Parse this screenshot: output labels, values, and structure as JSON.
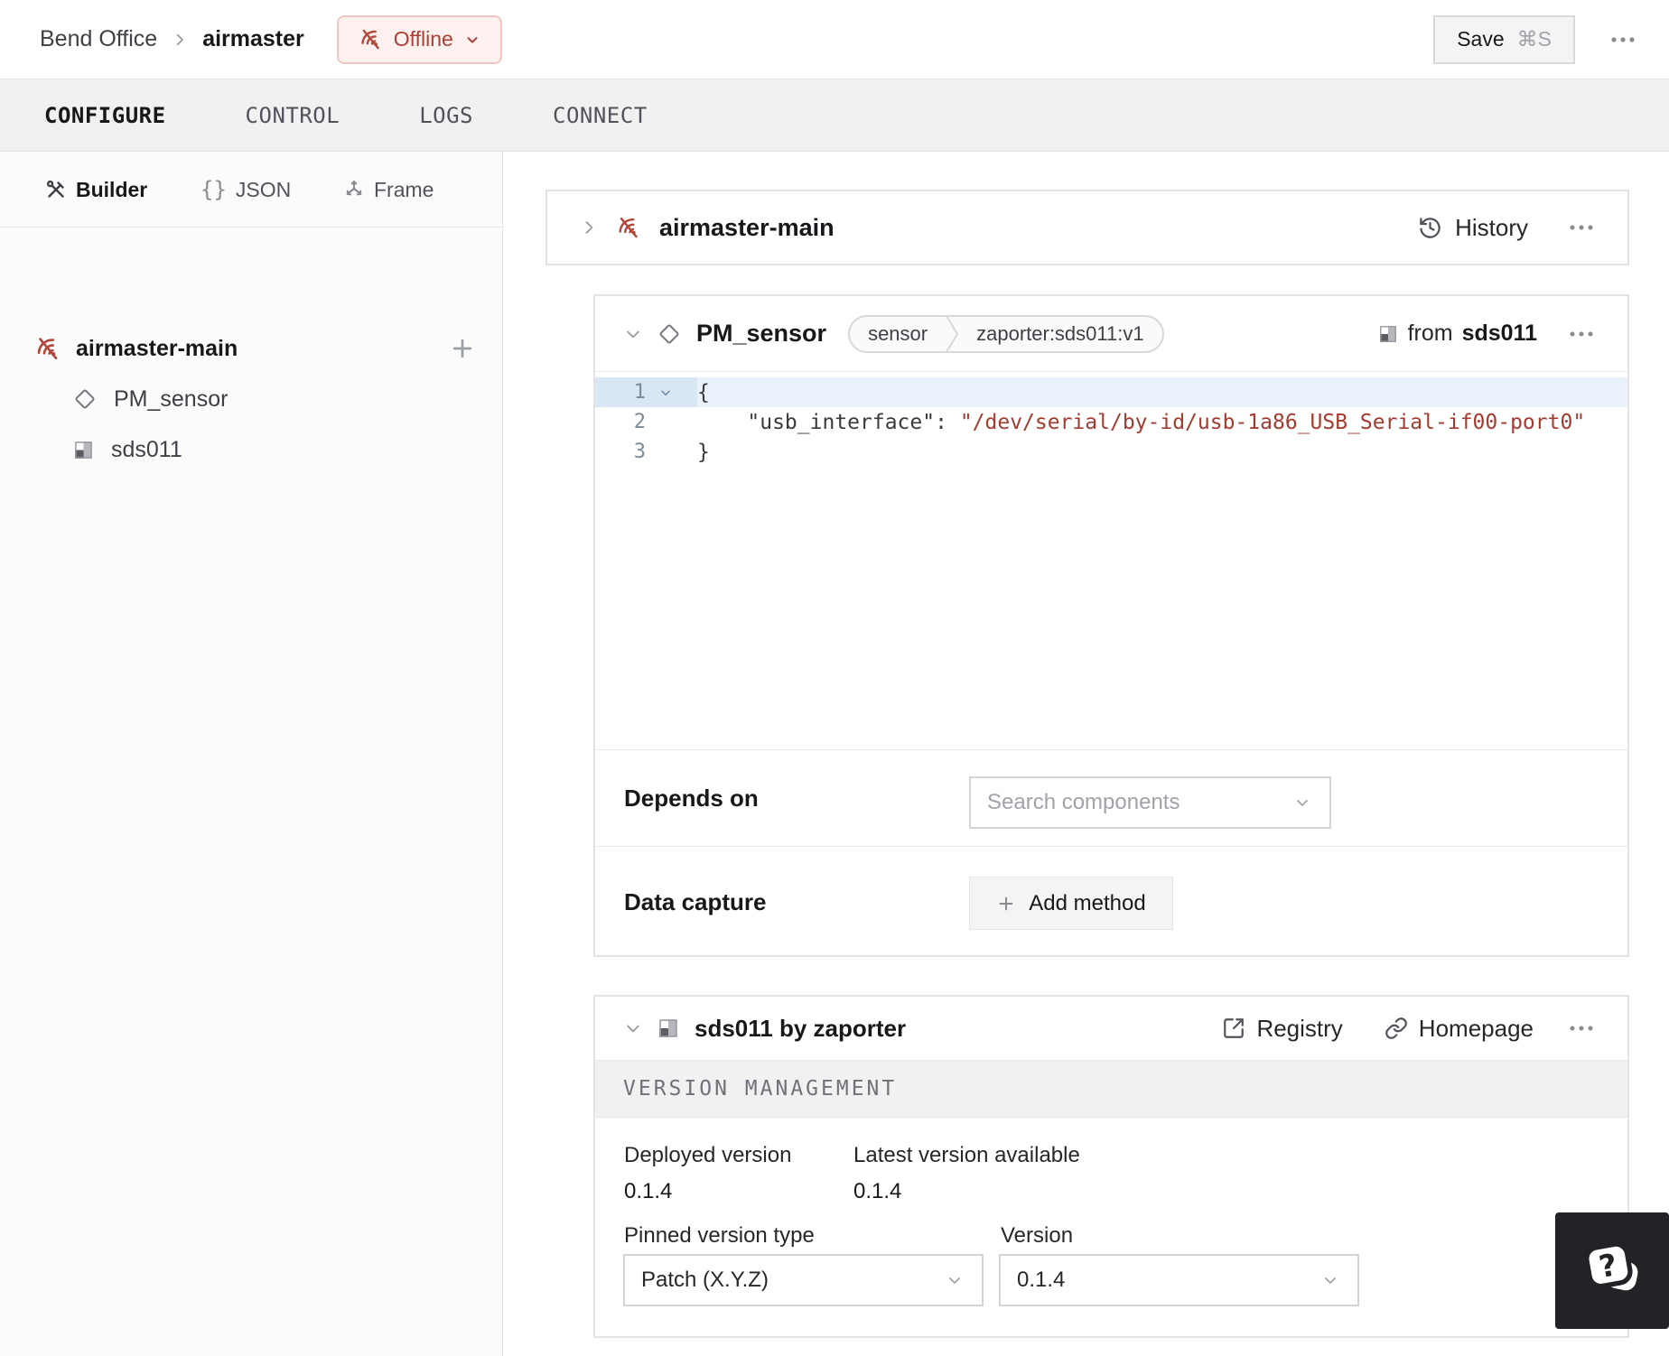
{
  "topbar": {
    "breadcrumb_parent": "Bend Office",
    "breadcrumb_current": "airmaster",
    "status_label": "Offline",
    "save_label": "Save",
    "save_shortcut": "⌘S"
  },
  "tabs": {
    "configure": "CONFIGURE",
    "control": "CONTROL",
    "logs": "LOGS",
    "connect": "CONNECT"
  },
  "sidebar": {
    "modes": {
      "builder": "Builder",
      "json": "JSON",
      "frame": "Frame"
    },
    "tree": {
      "root": "airmaster-main",
      "component": "PM_sensor",
      "module": "sds011"
    }
  },
  "machine_card": {
    "title": "airmaster-main",
    "history_label": "History"
  },
  "component_card": {
    "title": "PM_sensor",
    "chip_type": "sensor",
    "chip_model": "zaporter:sds011:v1",
    "from_label": "from",
    "from_module": "sds011",
    "code": {
      "gutter": [
        "1",
        "2",
        "3"
      ],
      "line1": "{",
      "line2_indent": "    ",
      "line2_key": "\"usb_interface\"",
      "line2_sep": ": ",
      "line2_value": "\"/dev/serial/by-id/usb-1a86_USB_Serial-if00-port0\"",
      "line3": "}"
    },
    "depends_on_label": "Depends on",
    "depends_on_placeholder": "Search components",
    "data_capture_label": "Data capture",
    "add_method_label": "Add method"
  },
  "module_card": {
    "title": "sds011 by zaporter",
    "registry_label": "Registry",
    "homepage_label": "Homepage",
    "section_header": "VERSION MANAGEMENT",
    "deployed_label": "Deployed version",
    "deployed_value": "0.1.4",
    "latest_label": "Latest version available",
    "latest_value": "0.1.4",
    "pinned_label": "Pinned version type",
    "pinned_value": "Patch (X.Y.Z)",
    "version_label": "Version",
    "version_value": "0.1.4"
  },
  "colors": {
    "offline_red": "#b3453a",
    "code_string_red": "#a33b30",
    "accent_dark": "#232327"
  }
}
